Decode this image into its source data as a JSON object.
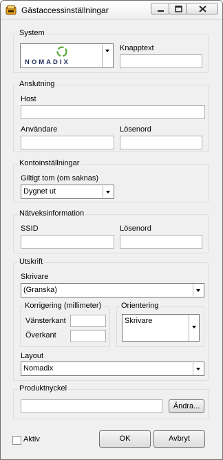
{
  "window": {
    "title": "Gästaccessinställningar"
  },
  "system": {
    "legend": "System",
    "logo_text": "NOMADIX",
    "button_text_label": "Knapptext",
    "button_text_value": ""
  },
  "connection": {
    "legend": "Anslutning",
    "host_label": "Host",
    "host_value": "",
    "user_label": "Användare",
    "user_value": "",
    "password_label": "Lösenord",
    "password_value": ""
  },
  "account": {
    "legend": "Kontoinställningar",
    "valid_label": "Giltigt tom (om saknas)",
    "valid_value": "Dygnet ut"
  },
  "network": {
    "legend": "Nätveksinformation",
    "ssid_label": "SSID",
    "ssid_value": "",
    "password_label": "Lösenord",
    "password_value": ""
  },
  "print": {
    "legend": "Utskrift",
    "printer_label": "Skrivare",
    "printer_value": "(Granska)",
    "correction_legend": "Korrigering (millimeter)",
    "left_margin_label": "Vänsterkant",
    "left_margin_value": "",
    "top_margin_label": "Överkant",
    "top_margin_value": "",
    "orientation_legend": "Orientering",
    "orientation_value": "Skrivare",
    "layout_label": "Layout",
    "layout_value": "Nomadix"
  },
  "product_key": {
    "legend": "Produktnyckel",
    "value": "",
    "change_button": "Ändra..."
  },
  "footer": {
    "active_label": "Aktiv",
    "active_checked": false,
    "ok_button": "OK",
    "cancel_button": "Avbryt"
  },
  "colors": {
    "logo_green": "#5aa83c",
    "logo_navy": "#1c2c5e"
  }
}
